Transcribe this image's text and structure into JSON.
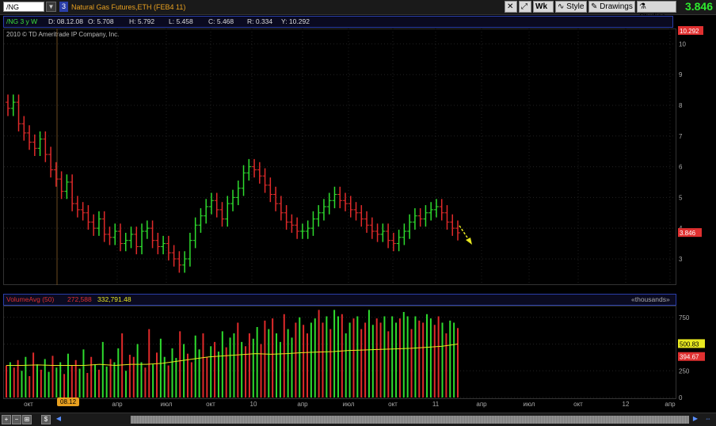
{
  "toolbar": {
    "symbol": "/NG",
    "link_number": "3",
    "description": "Natural Gas Futures,ETH (FEB4 11)",
    "timeframe_label": "Wk",
    "style_label": "Style",
    "drawings_label": "Drawings",
    "studies_label": "Studies",
    "last_price": "3.846",
    "last_price_color": "#2eea2e"
  },
  "infobar": {
    "title": "/NG 3 y W",
    "date": "D: 08.12.08",
    "open": "O: 5.708",
    "high": "H: 5.792",
    "low": "L: 5.458",
    "close": "C: 5.468",
    "range": "R: 0.334",
    "y": "Y: 10.292"
  },
  "copyright": "2010 © TD Ameritrade IP Company, Inc.",
  "volume_header": {
    "name": "VolumeAvg (50)",
    "val1": "272,588",
    "val2": "332,791.48",
    "units": "«thousands»"
  },
  "date_badge": "08.12",
  "chart_data": [
    {
      "type": "candlestick",
      "description": "Weekly OHLC price bars, green up / red down",
      "y_ticks": [
        "10",
        "9",
        "8",
        "7",
        "6",
        "5",
        "4",
        "3"
      ],
      "ylim": [
        2.2,
        10.5
      ],
      "price_tags": {
        "top": "10.292",
        "last": "3.846"
      },
      "series": [
        {
          "name": "price",
          "values": [
            7.9,
            8.1,
            7.4,
            7.1,
            6.8,
            6.6,
            6.9,
            6.4,
            5.9,
            5.6,
            5.2,
            5.5,
            4.8,
            4.6,
            4.5,
            4.2,
            4.0,
            4.3,
            3.8,
            3.7,
            3.9,
            3.5,
            3.6,
            3.8,
            3.4,
            3.9,
            4.0,
            3.6,
            3.4,
            3.5,
            3.2,
            3.0,
            2.8,
            3.0,
            3.6,
            4.1,
            4.4,
            4.7,
            4.9,
            4.6,
            4.3,
            4.8,
            5.0,
            5.3,
            5.8,
            6.0,
            5.9,
            5.7,
            5.4,
            5.1,
            4.8,
            4.5,
            4.2,
            4.1,
            3.9,
            3.9,
            4.0,
            4.3,
            4.5,
            4.7,
            4.9,
            5.1,
            4.9,
            4.8,
            4.6,
            4.5,
            4.3,
            4.1,
            3.9,
            3.8,
            3.9,
            3.6,
            3.5,
            3.7,
            3.9,
            4.2,
            4.4,
            4.3,
            4.5,
            4.6,
            4.7,
            4.5,
            4.2,
            4.0,
            3.85
          ]
        }
      ]
    },
    {
      "type": "bar",
      "description": "Weekly volume histogram with 50-period average line",
      "y_ticks": [
        "750",
        "500",
        "250",
        "0"
      ],
      "ylim": [
        0,
        830
      ],
      "value_tags": {
        "avg": "500.83",
        "vol": "394.67"
      },
      "x_ticks": [
        "окт",
        "08.12",
        "апр",
        "июл",
        "окт",
        "10",
        "апр",
        "июл",
        "окт",
        "11",
        "апр",
        "июл",
        "окт",
        "12",
        "апр"
      ],
      "avg_line_color": "#e8e820",
      "avg_values": [
        300,
        300,
        305,
        300,
        300,
        300,
        310,
        300,
        310,
        310,
        320,
        340,
        360,
        380,
        390,
        400,
        410,
        405,
        410,
        420,
        425,
        430,
        440,
        445,
        450,
        455,
        460,
        470,
        480,
        500
      ],
      "volume_values": [
        300,
        330,
        280,
        350,
        250,
        380,
        200,
        420,
        310,
        260,
        360,
        240,
        390,
        280,
        330,
        220,
        410,
        300,
        350,
        270,
        450,
        230,
        380,
        310,
        260,
        520,
        290,
        360,
        330,
        460,
        600,
        250,
        400,
        380,
        500,
        330,
        280,
        640,
        310,
        420,
        550,
        380,
        300,
        460,
        370,
        620,
        500,
        410,
        330,
        580,
        450,
        600,
        380,
        480,
        520,
        430,
        620,
        470,
        560,
        600,
        700,
        520,
        480,
        600,
        550,
        660,
        500,
        720,
        640,
        740,
        600,
        520,
        780,
        640,
        560,
        700,
        750,
        680,
        600,
        700,
        740,
        820,
        700,
        760,
        640,
        820,
        760,
        780,
        600,
        700,
        740,
        760,
        640,
        700,
        820,
        680,
        740,
        700,
        760,
        620,
        760,
        700,
        740,
        800,
        760,
        640,
        760,
        720,
        700,
        780,
        740,
        680,
        760,
        700,
        600,
        720,
        700,
        650
      ]
    }
  ]
}
